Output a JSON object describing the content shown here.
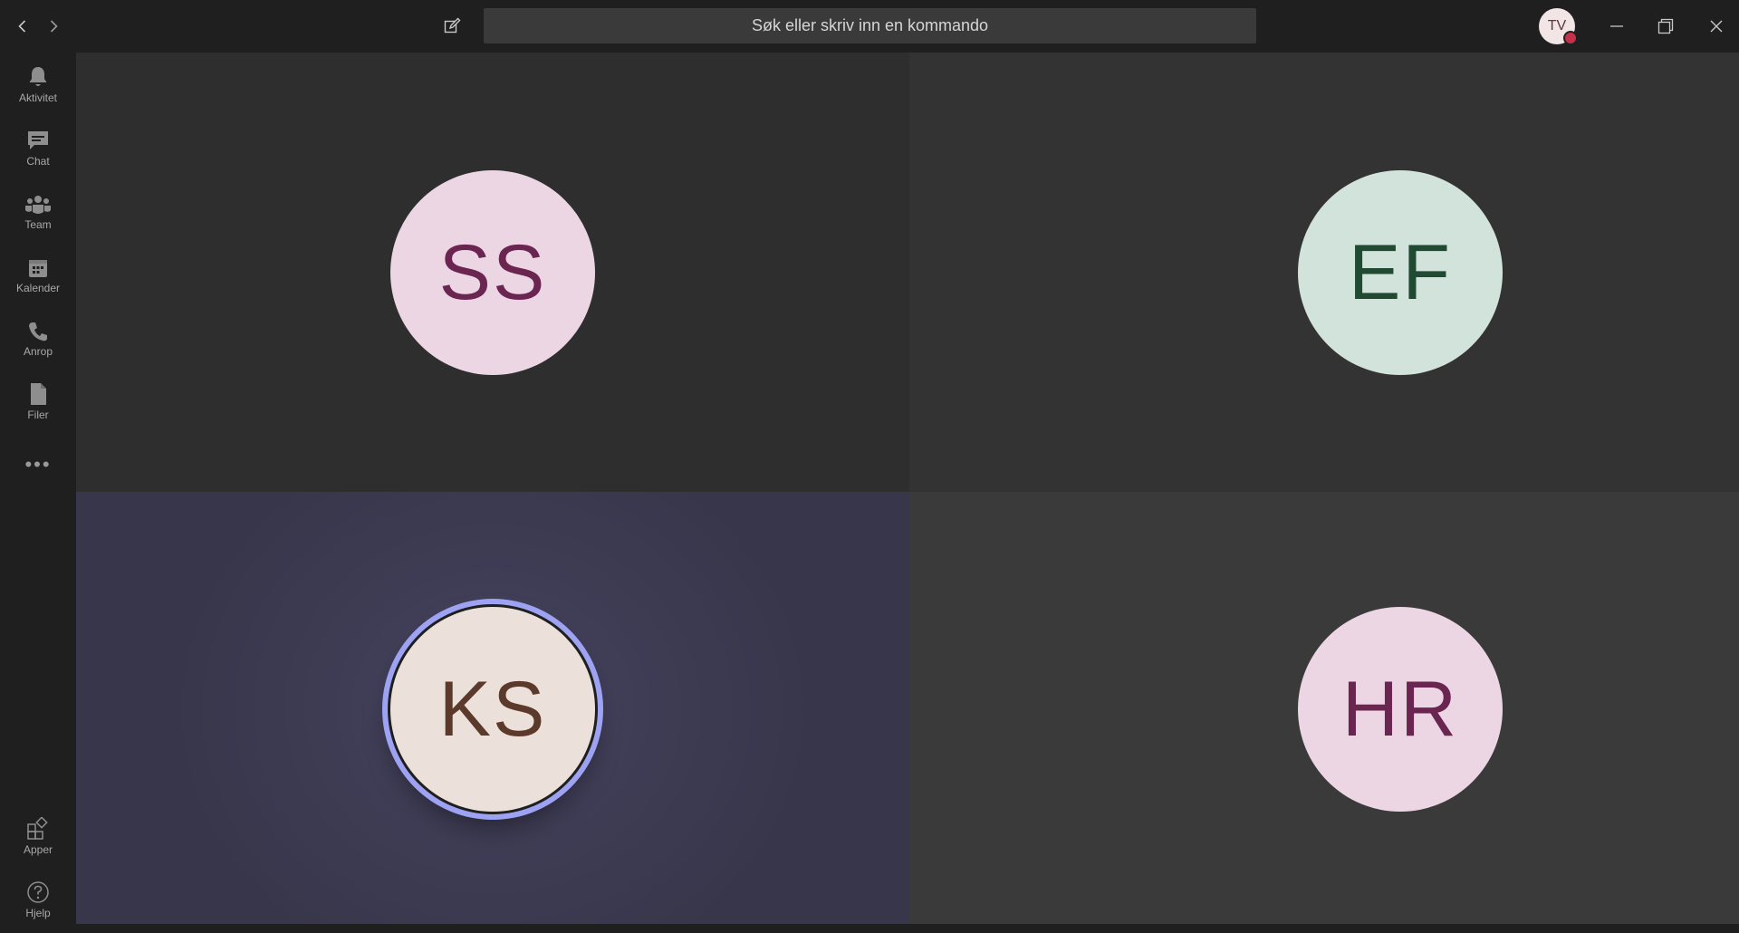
{
  "titlebar": {
    "search_placeholder": "Søk eller skriv inn en kommando",
    "profile_initials": "TV",
    "presence_status": "busy",
    "icons": {
      "back": "chevron-left-icon",
      "forward": "chevron-right-icon",
      "compose": "compose-icon",
      "minimize": "minimize-icon",
      "restore": "restore-icon",
      "close": "close-icon"
    }
  },
  "rail": {
    "items": [
      {
        "label": "Aktivitet",
        "icon": "bell-icon"
      },
      {
        "label": "Chat",
        "icon": "chat-icon"
      },
      {
        "label": "Team",
        "icon": "teams-icon"
      },
      {
        "label": "Kalender",
        "icon": "calendar-icon"
      },
      {
        "label": "Anrop",
        "icon": "phone-icon"
      },
      {
        "label": "Filer",
        "icon": "file-icon"
      }
    ],
    "more_label": "•••",
    "bottom_items": [
      {
        "label": "Apper",
        "icon": "apps-icon"
      },
      {
        "label": "Hjelp",
        "icon": "help-icon"
      }
    ]
  },
  "participants": [
    {
      "initials": "SS",
      "color": "#6b2551",
      "bg": "#ecd6e4",
      "speaking": false
    },
    {
      "initials": "EF",
      "color": "#204a32",
      "bg": "#d1e3da",
      "speaking": false
    },
    {
      "initials": "KS",
      "color": "#5b3a2c",
      "bg": "#ece0da",
      "speaking": true
    },
    {
      "initials": "HR",
      "color": "#6b2551",
      "bg": "#ecd6e4",
      "speaking": false
    }
  ],
  "colors": {
    "speaking_ring": "#9ea2f3",
    "busy_presence": "#c4314b"
  }
}
